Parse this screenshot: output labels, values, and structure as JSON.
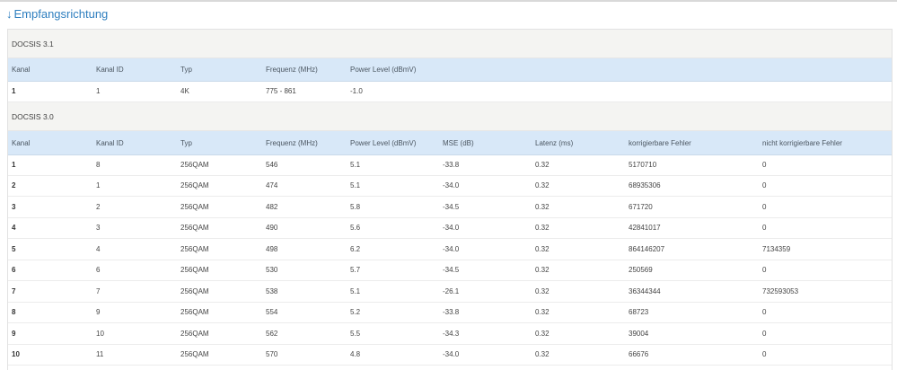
{
  "page": {
    "heading_arrow": "↓",
    "heading": "Empfangsrichtung"
  },
  "docsis31": {
    "title": "DOCSIS 3.1",
    "headers": [
      "Kanal",
      "Kanal ID",
      "Typ",
      "Frequenz (MHz)",
      "Power Level (dBmV)"
    ],
    "rows": [
      [
        "1",
        "1",
        "4K",
        "775 - 861",
        "-1.0"
      ]
    ]
  },
  "docsis30": {
    "title": "DOCSIS 3.0",
    "headers": [
      "Kanal",
      "Kanal ID",
      "Typ",
      "Frequenz (MHz)",
      "Power Level (dBmV)",
      "MSE (dB)",
      "Latenz (ms)",
      "korrigierbare Fehler",
      "nicht korrigierbare Fehler"
    ],
    "rows": [
      [
        "1",
        "8",
        "256QAM",
        "546",
        "5.1",
        "-33.8",
        "0.32",
        "5170710",
        "0"
      ],
      [
        "2",
        "1",
        "256QAM",
        "474",
        "5.1",
        "-34.0",
        "0.32",
        "68935306",
        "0"
      ],
      [
        "3",
        "2",
        "256QAM",
        "482",
        "5.8",
        "-34.5",
        "0.32",
        "671720",
        "0"
      ],
      [
        "4",
        "3",
        "256QAM",
        "490",
        "5.6",
        "-34.0",
        "0.32",
        "42841017",
        "0"
      ],
      [
        "5",
        "4",
        "256QAM",
        "498",
        "6.2",
        "-34.0",
        "0.32",
        "864146207",
        "7134359"
      ],
      [
        "6",
        "6",
        "256QAM",
        "530",
        "5.7",
        "-34.5",
        "0.32",
        "250569",
        "0"
      ],
      [
        "7",
        "7",
        "256QAM",
        "538",
        "5.1",
        "-26.1",
        "0.32",
        "36344344",
        "732593053"
      ],
      [
        "8",
        "9",
        "256QAM",
        "554",
        "5.2",
        "-33.8",
        "0.32",
        "68723",
        "0"
      ],
      [
        "9",
        "10",
        "256QAM",
        "562",
        "5.5",
        "-34.3",
        "0.32",
        "39004",
        "0"
      ],
      [
        "10",
        "11",
        "256QAM",
        "570",
        "4.8",
        "-34.0",
        "0.32",
        "66676",
        "0"
      ]
    ]
  }
}
